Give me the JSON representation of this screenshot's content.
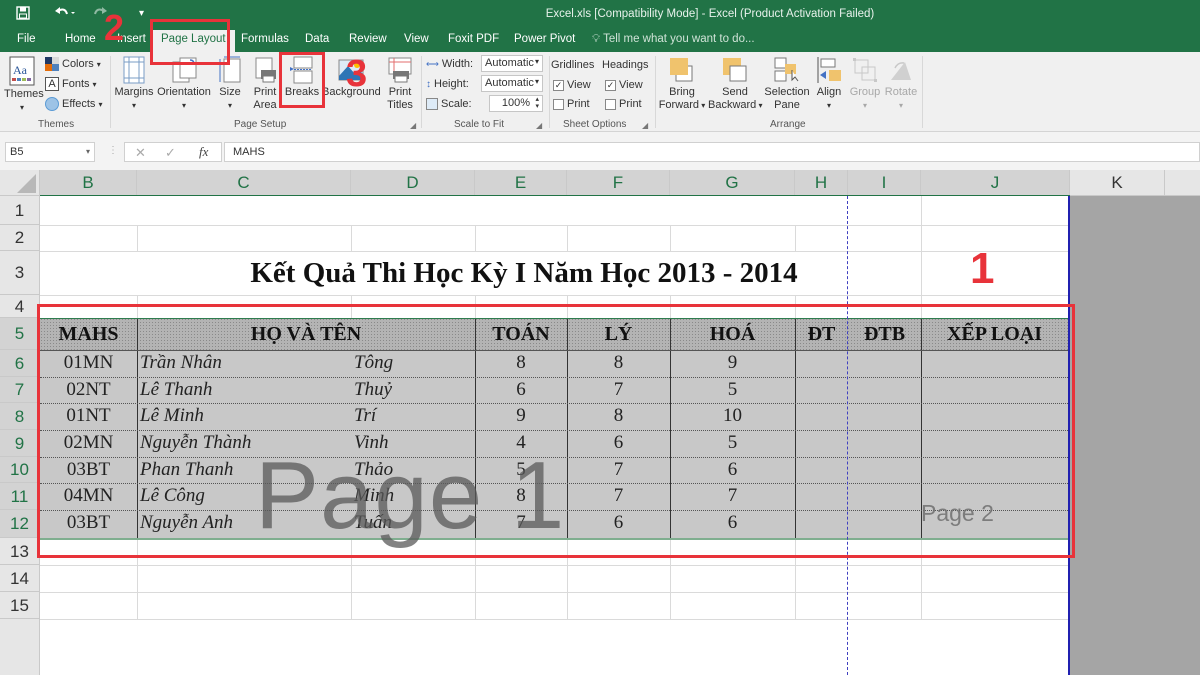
{
  "window": {
    "title": "Excel.xls  [Compatibility Mode] - Excel (Product Activation Failed)"
  },
  "quick_access": {
    "save_icon": "save-icon",
    "undo_icon": "undo-icon",
    "redo_icon": "redo-icon",
    "customize_icon": "customize-icon"
  },
  "tabs": [
    {
      "label": "File"
    },
    {
      "label": "Home"
    },
    {
      "label": "Insert"
    },
    {
      "label": "Page Layout",
      "active": true
    },
    {
      "label": "Formulas"
    },
    {
      "label": "Data"
    },
    {
      "label": "Review"
    },
    {
      "label": "View"
    },
    {
      "label": "Foxit PDF"
    },
    {
      "label": "Power Pivot"
    }
  ],
  "tell_me": "Tell me what you want to do...",
  "ribbon": {
    "themes": {
      "group_label": "Themes",
      "themes_label": "Themes",
      "colors_label": "Colors",
      "fonts_label": "Fonts",
      "effects_label": "Effects"
    },
    "page_setup": {
      "group_label": "Page Setup",
      "margins": "Margins",
      "orientation": "Orientation",
      "size": "Size",
      "print_area_1": "Print",
      "print_area_2": "Area",
      "breaks": "Breaks",
      "background": "Background",
      "print_titles_1": "Print",
      "print_titles_2": "Titles"
    },
    "scale_to_fit": {
      "group_label": "Scale to Fit",
      "width_label": "Width:",
      "width_value": "Automatic",
      "height_label": "Height:",
      "height_value": "Automatic",
      "scale_label": "Scale:",
      "scale_value": "100%"
    },
    "sheet_options": {
      "group_label": "Sheet Options",
      "gridlines": "Gridlines",
      "headings": "Headings",
      "view": "View",
      "print": "Print",
      "gridlines_view_checked": true,
      "gridlines_print_checked": false,
      "headings_view_checked": true,
      "headings_print_checked": false
    },
    "arrange": {
      "group_label": "Arrange",
      "bring_forward_1": "Bring",
      "bring_forward_2": "Forward",
      "send_backward_1": "Send",
      "send_backward_2": "Backward",
      "selection_pane_1": "Selection",
      "selection_pane_2": "Pane",
      "align": "Align",
      "group": "Group",
      "rotate": "Rotate"
    }
  },
  "formula_bar": {
    "name_box": "B5",
    "cancel_icon": "cancel-icon",
    "enter_icon": "enter-icon",
    "fx_label": "fx",
    "content": "MAHS"
  },
  "columns": [
    "B",
    "C",
    "D",
    "E",
    "F",
    "G",
    "H",
    "I",
    "J",
    "K"
  ],
  "rows": [
    "1",
    "2",
    "3",
    "4",
    "5",
    "6",
    "7",
    "8",
    "9",
    "10",
    "11",
    "12",
    "13",
    "14",
    "15"
  ],
  "sheet": {
    "title": "Kết Quả Thi Học Kỳ I Năm Học 2013 - 2014",
    "headers": {
      "mahs": "MAHS",
      "ho_va_ten": "HỌ VÀ TÊN",
      "toan": "TOÁN",
      "ly": "LÝ",
      "hoa": "HOÁ",
      "dt": "ĐT",
      "dtb": "ĐTB",
      "xep_loai": "XẾP LOẠI"
    },
    "records": [
      {
        "mahs": "01MN",
        "ho": "Trần Nhân",
        "ten": "Tông",
        "toan": "8",
        "ly": "8",
        "hoa": "9"
      },
      {
        "mahs": "02NT",
        "ho": "Lê Thanh",
        "ten": "Thuỷ",
        "toan": "6",
        "ly": "7",
        "hoa": "5"
      },
      {
        "mahs": "01NT",
        "ho": "Lê Minh",
        "ten": "Trí",
        "toan": "9",
        "ly": "8",
        "hoa": "10"
      },
      {
        "mahs": "02MN",
        "ho": "Nguyễn Thành",
        "ten": "Vinh",
        "toan": "4",
        "ly": "6",
        "hoa": "5"
      },
      {
        "mahs": "03BT",
        "ho": "Phan Thanh",
        "ten": "Thảo",
        "toan": "5",
        "ly": "7",
        "hoa": "6"
      },
      {
        "mahs": "04MN",
        "ho": "Lê Công",
        "ten": "Minh",
        "toan": "8",
        "ly": "7",
        "hoa": "7"
      },
      {
        "mahs": "03BT",
        "ho": "Nguyễn Anh",
        "ten": "Tuấn",
        "toan": "7",
        "ly": "6",
        "hoa": "6"
      }
    ],
    "page_watermarks": [
      "Page 1",
      "Page 2"
    ]
  },
  "annotations": [
    "1",
    "2",
    "3"
  ],
  "colors": {
    "excel_green": "#217346",
    "annotation_red": "#e8333a",
    "page_break_blue": "#2020b0",
    "table_fill": "#c8c8c8"
  }
}
